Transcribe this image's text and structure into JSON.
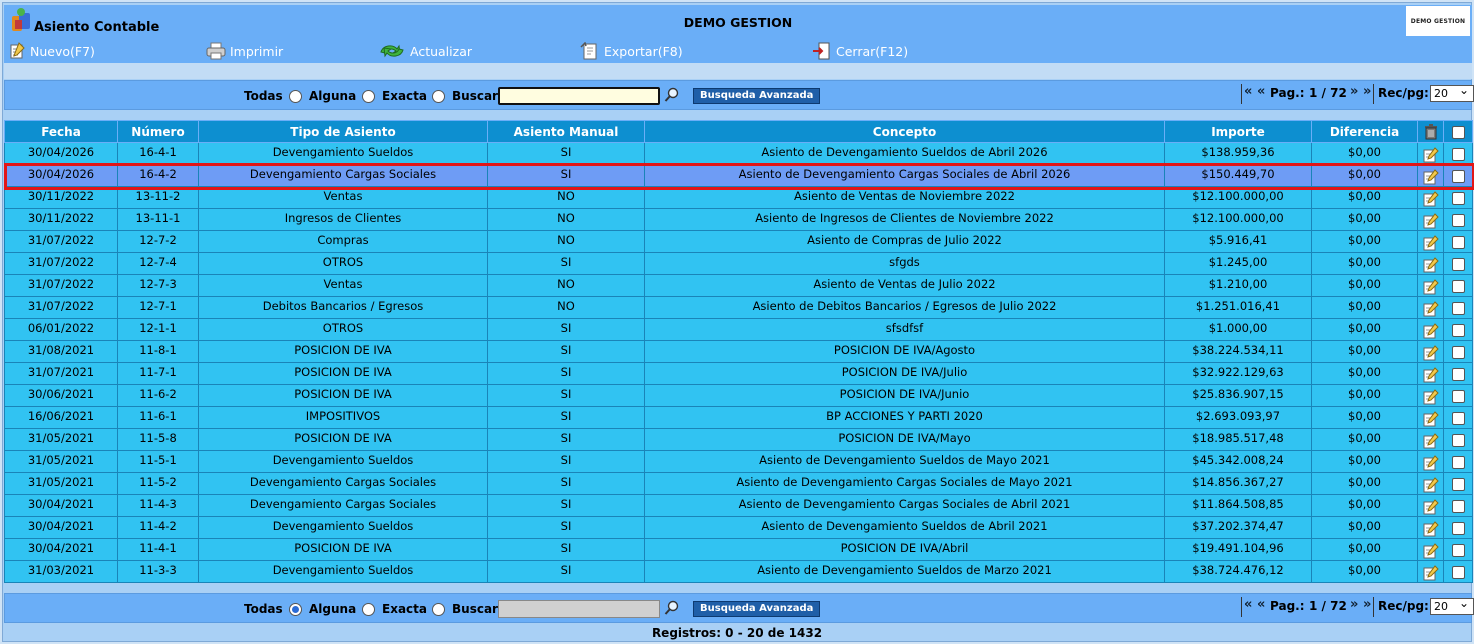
{
  "app": {
    "title": "Asiento Contable",
    "brand": "DEMO GESTION",
    "brand_logo_text": "DEMO GESTION"
  },
  "toolbar": {
    "nuevo": "Nuevo(F7)",
    "imprimir": "Imprimir",
    "actualizar": "Actualizar",
    "exportar": "Exportar(F8)",
    "cerrar": "Cerrar(F12)"
  },
  "search_top": {
    "todas": "Todas",
    "alguna": "Alguna",
    "exacta": "Exacta",
    "buscar": "Buscar",
    "value": "",
    "advanced": "Busqueda Avanzada",
    "page_label": "Pag.:",
    "page": "1 / 72",
    "recpg_label": "Rec/pg:",
    "recpg": "20",
    "selected_mode": "none"
  },
  "search_bottom": {
    "todas": "Todas",
    "alguna": "Alguna",
    "exacta": "Exacta",
    "buscar": "Buscar",
    "value": "",
    "advanced": "Busqueda Avanzada",
    "page_label": "Pag.:",
    "page": "1 / 72",
    "recpg_label": "Rec/pg:",
    "recpg": "20",
    "selected_mode": "alguna"
  },
  "table": {
    "headers": [
      "Fecha",
      "Número",
      "Tipo de Asiento",
      "Asiento Manual",
      "Concepto",
      "Importe",
      "Diferencia"
    ],
    "selected_row": 1,
    "rows": [
      [
        "30/04/2026",
        "16-4-1",
        "Devengamiento Sueldos",
        "SI",
        "Asiento de Devengamiento Sueldos de Abril 2026",
        "$138.959,36",
        "$0,00"
      ],
      [
        "30/04/2026",
        "16-4-2",
        "Devengamiento Cargas Sociales",
        "SI",
        "Asiento de Devengamiento Cargas Sociales de Abril 2026",
        "$150.449,70",
        "$0,00"
      ],
      [
        "30/11/2022",
        "13-11-2",
        "Ventas",
        "NO",
        "Asiento de Ventas de Noviembre 2022",
        "$12.100.000,00",
        "$0,00"
      ],
      [
        "30/11/2022",
        "13-11-1",
        "Ingresos de Clientes",
        "NO",
        "Asiento de Ingresos de Clientes de Noviembre 2022",
        "$12.100.000,00",
        "$0,00"
      ],
      [
        "31/07/2022",
        "12-7-2",
        "Compras",
        "NO",
        "Asiento de Compras de Julio 2022",
        "$5.916,41",
        "$0,00"
      ],
      [
        "31/07/2022",
        "12-7-4",
        "OTROS",
        "SI",
        "sfgds",
        "$1.245,00",
        "$0,00"
      ],
      [
        "31/07/2022",
        "12-7-3",
        "Ventas",
        "NO",
        "Asiento de Ventas de Julio 2022",
        "$1.210,00",
        "$0,00"
      ],
      [
        "31/07/2022",
        "12-7-1",
        "Debitos Bancarios / Egresos",
        "NO",
        "Asiento de Debitos Bancarios / Egresos de Julio 2022",
        "$1.251.016,41",
        "$0,00"
      ],
      [
        "06/01/2022",
        "12-1-1",
        "OTROS",
        "SI",
        "sfsdfsf",
        "$1.000,00",
        "$0,00"
      ],
      [
        "31/08/2021",
        "11-8-1",
        "POSICION DE IVA",
        "SI",
        "POSICION DE IVA/Agosto",
        "$38.224.534,11",
        "$0,00"
      ],
      [
        "31/07/2021",
        "11-7-1",
        "POSICION DE IVA",
        "SI",
        "POSICION DE IVA/Julio",
        "$32.922.129,63",
        "$0,00"
      ],
      [
        "30/06/2021",
        "11-6-2",
        "POSICION DE IVA",
        "SI",
        "POSICION DE IVA/Junio",
        "$25.836.907,15",
        "$0,00"
      ],
      [
        "16/06/2021",
        "11-6-1",
        "IMPOSITIVOS",
        "SI",
        "BP ACCIONES Y PARTI 2020",
        "$2.693.093,97",
        "$0,00"
      ],
      [
        "31/05/2021",
        "11-5-8",
        "POSICION DE IVA",
        "SI",
        "POSICION DE IVA/Mayo",
        "$18.985.517,48",
        "$0,00"
      ],
      [
        "31/05/2021",
        "11-5-1",
        "Devengamiento Sueldos",
        "SI",
        "Asiento de Devengamiento Sueldos de Mayo 2021",
        "$45.342.008,24",
        "$0,00"
      ],
      [
        "31/05/2021",
        "11-5-2",
        "Devengamiento Cargas Sociales",
        "SI",
        "Asiento de Devengamiento Cargas Sociales de Mayo 2021",
        "$14.856.367,27",
        "$0,00"
      ],
      [
        "30/04/2021",
        "11-4-3",
        "Devengamiento Cargas Sociales",
        "SI",
        "Asiento de Devengamiento Cargas Sociales de Abril 2021",
        "$11.864.508,85",
        "$0,00"
      ],
      [
        "30/04/2021",
        "11-4-2",
        "Devengamiento Sueldos",
        "SI",
        "Asiento de Devengamiento Sueldos de Abril 2021",
        "$37.202.374,47",
        "$0,00"
      ],
      [
        "30/04/2021",
        "11-4-1",
        "POSICION DE IVA",
        "SI",
        "POSICION DE IVA/Abril",
        "$19.491.104,96",
        "$0,00"
      ],
      [
        "31/03/2021",
        "11-3-3",
        "Devengamiento Sueldos",
        "SI",
        "Asiento de Devengamiento Sueldos de Marzo 2021",
        "$38.724.476,12",
        "$0,00"
      ]
    ]
  },
  "footer": "Registros: 0 - 20 de 1432"
}
